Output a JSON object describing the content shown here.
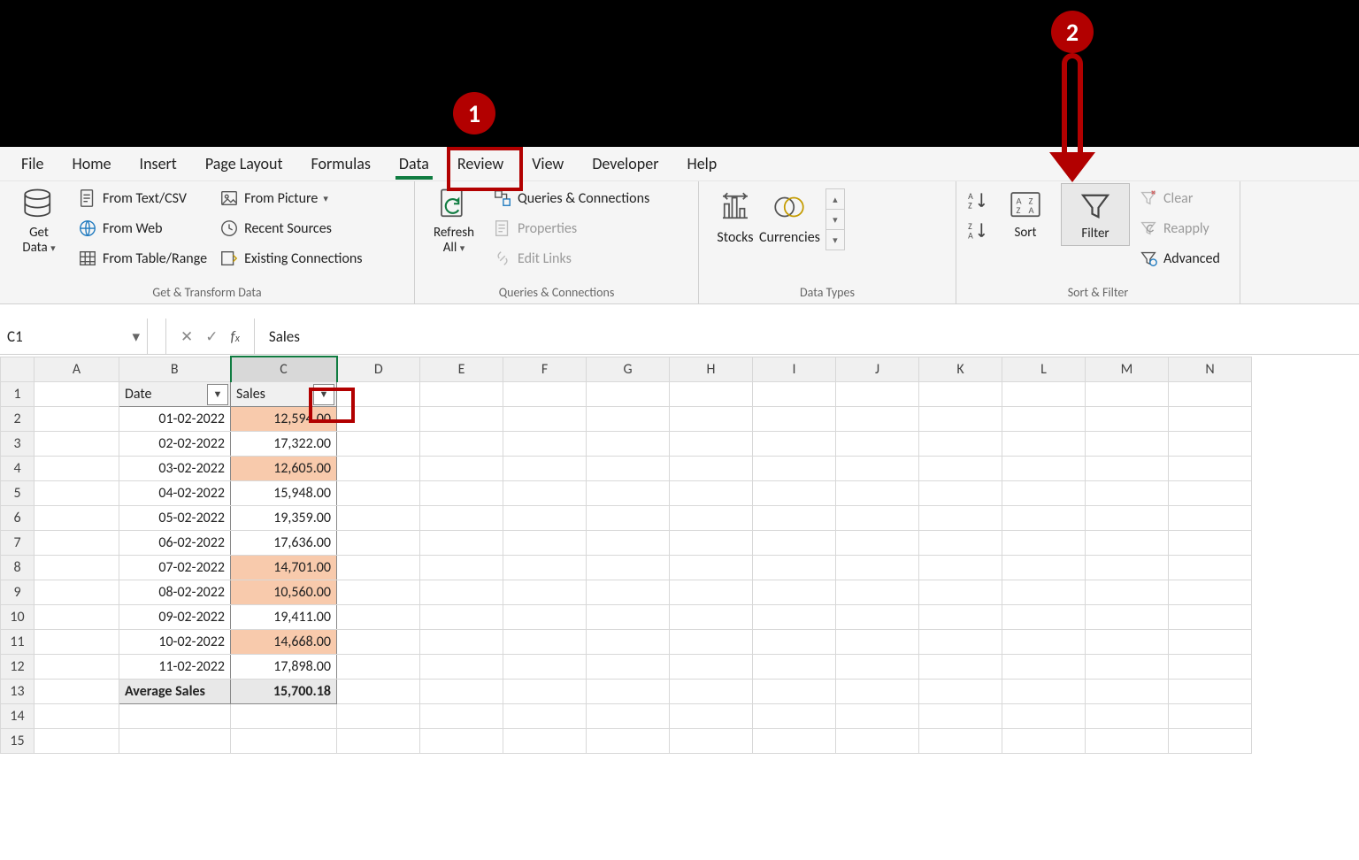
{
  "tabs": {
    "file": "File",
    "home": "Home",
    "insert": "Insert",
    "pageLayout": "Page Layout",
    "formulas": "Formulas",
    "data": "Data",
    "review": "Review",
    "view": "View",
    "developer": "Developer",
    "help": "Help"
  },
  "ribbon": {
    "getData": "Get\nData",
    "fromTextCsv": "From Text/CSV",
    "fromWeb": "From Web",
    "fromTableRange": "From Table/Range",
    "fromPicture": "From Picture",
    "recentSources": "Recent Sources",
    "existingConnections": "Existing Connections",
    "group1": "Get & Transform Data",
    "refreshAll": "Refresh\nAll",
    "queriesConn": "Queries & Connections",
    "properties": "Properties",
    "editLinks": "Edit Links",
    "group2": "Queries & Connections",
    "stocks": "Stocks",
    "currencies": "Currencies",
    "group3": "Data Types",
    "sort": "Sort",
    "filter": "Filter",
    "clear": "Clear",
    "reapply": "Reapply",
    "advanced": "Advanced",
    "group4": "Sort & Filter"
  },
  "nameBox": "C1",
  "formula": "Sales",
  "columns": [
    "A",
    "B",
    "C",
    "D",
    "E",
    "F",
    "G",
    "H",
    "I",
    "J",
    "K",
    "L",
    "M",
    "N"
  ],
  "header": {
    "date": "Date",
    "sales": "Sales"
  },
  "rows": [
    {
      "date": "01-02-2022",
      "sales": "12,594.00",
      "hl": true
    },
    {
      "date": "02-02-2022",
      "sales": "17,322.00",
      "hl": false
    },
    {
      "date": "03-02-2022",
      "sales": "12,605.00",
      "hl": true
    },
    {
      "date": "04-02-2022",
      "sales": "15,948.00",
      "hl": false
    },
    {
      "date": "05-02-2022",
      "sales": "19,359.00",
      "hl": false
    },
    {
      "date": "06-02-2022",
      "sales": "17,636.00",
      "hl": false
    },
    {
      "date": "07-02-2022",
      "sales": "14,701.00",
      "hl": true
    },
    {
      "date": "08-02-2022",
      "sales": "10,560.00",
      "hl": true
    },
    {
      "date": "09-02-2022",
      "sales": "19,411.00",
      "hl": false
    },
    {
      "date": "10-02-2022",
      "sales": "14,668.00",
      "hl": true
    },
    {
      "date": "11-02-2022",
      "sales": "17,898.00",
      "hl": false
    }
  ],
  "summary": {
    "label": "Average Sales",
    "value": "15,700.18"
  },
  "annotations": {
    "one": "1",
    "two": "2"
  }
}
